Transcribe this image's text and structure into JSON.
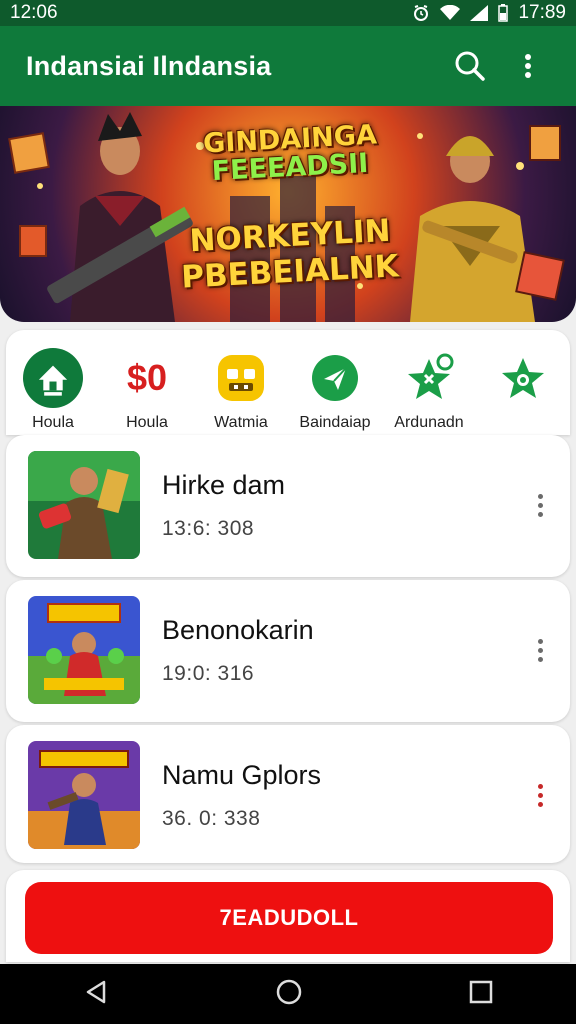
{
  "status_bar": {
    "time_left": "12:06",
    "time_right": "17:89"
  },
  "app_bar": {
    "title": "Indansiai Ilndansia",
    "icons": [
      "search-icon",
      "more-vert-icon"
    ]
  },
  "banner": {
    "line1": "GINDAINGA",
    "line2": "FEEEADSII",
    "line3": "NORKEYLIN",
    "line4": "PBEBEIALNK"
  },
  "categories": [
    {
      "label": "Houla",
      "icon": "home-icon",
      "color": "#0f7a3b"
    },
    {
      "label": "$0",
      "caption": "Houla",
      "icon": "dollar-text",
      "color": "#d71f1f"
    },
    {
      "label": "Watmia",
      "icon": "robot-face-icon",
      "color": "#f6c400"
    },
    {
      "label": "Baindaiap",
      "icon": "send-icon",
      "color": "#1b9e48"
    },
    {
      "label": "Ardunadn",
      "icon": "star-icon",
      "color": "#1b9e48"
    },
    {
      "label": "",
      "icon": "star-badge-icon",
      "color": "#1b9e48"
    }
  ],
  "games": [
    {
      "title": "Hirke dam",
      "subtitle": "13:6: 308",
      "menu_color": "#6a6a6a"
    },
    {
      "title": "Benonokarin",
      "subtitle": "19:0: 316",
      "menu_color": "#6a6a6a"
    },
    {
      "title": "Namu Gplors",
      "subtitle": "36. 0: 338",
      "menu_color": "#c62828"
    }
  ],
  "primary_button": {
    "label": "7EADUDOLL",
    "color": "#ee1010"
  },
  "nav_bar": {
    "icons": [
      "back-icon",
      "home-circle-icon",
      "recents-icon"
    ]
  }
}
